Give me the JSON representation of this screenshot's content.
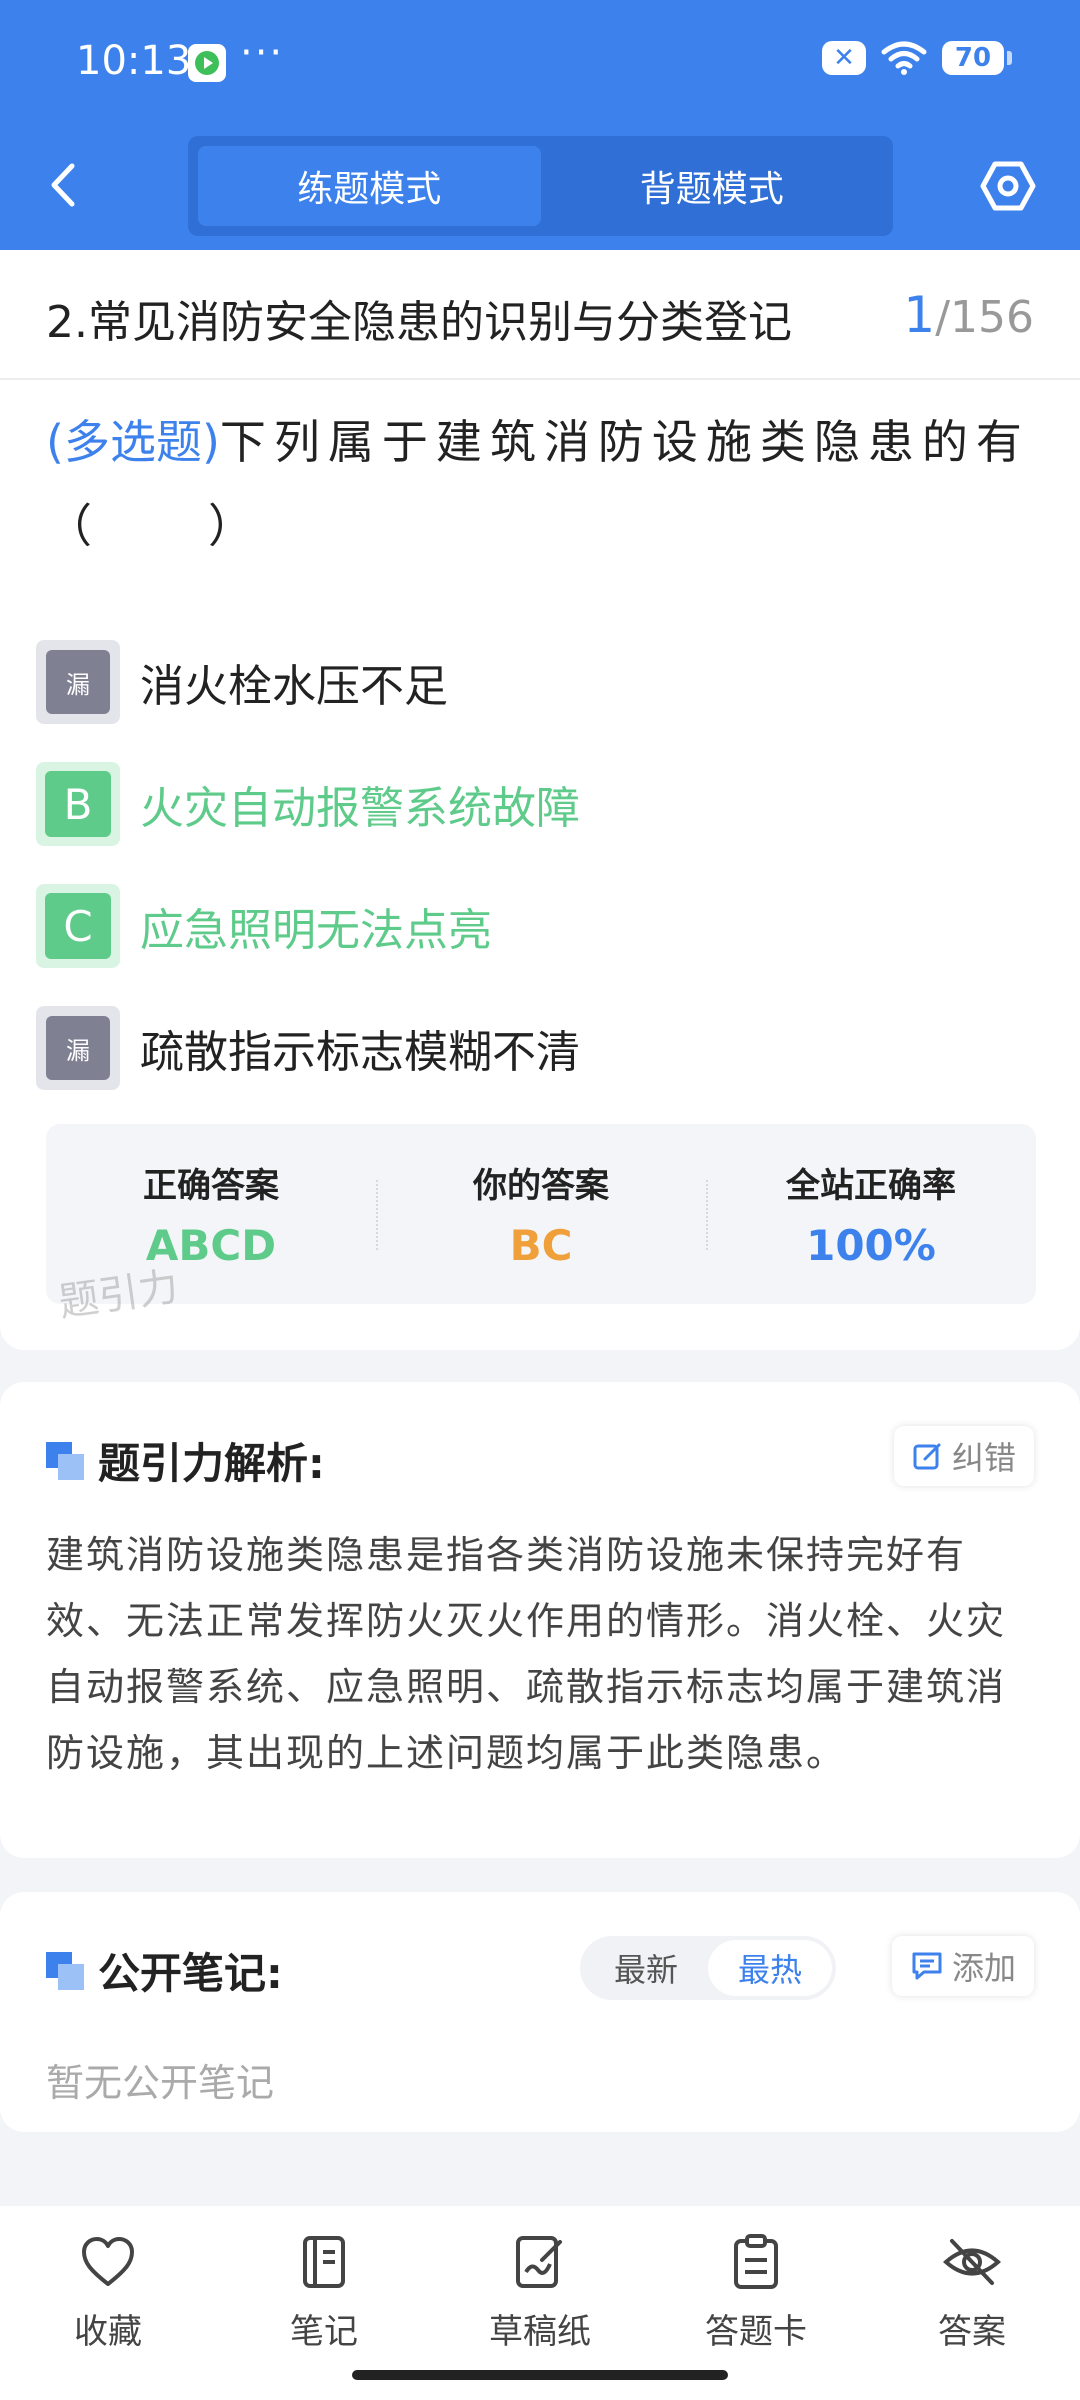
{
  "status_bar": {
    "time": "10:13",
    "dots": "···",
    "battery": "70"
  },
  "header": {
    "tabs": [
      {
        "label": "练题模式",
        "active": true
      },
      {
        "label": "背题模式",
        "active": false
      }
    ]
  },
  "question": {
    "section_title": "2.常见消防安全隐患的识别与分类登记",
    "current": "1",
    "total": "/156",
    "type": "(多选题)",
    "stem": "下列属于建筑消防设施类隐患的有（　　）",
    "options": [
      {
        "mark": "漏",
        "text": "消火栓水压不足",
        "state": "missed"
      },
      {
        "mark": "B",
        "text": "火灾自动报警系统故障",
        "state": "correct"
      },
      {
        "mark": "C",
        "text": "应急照明无法点亮",
        "state": "correct"
      },
      {
        "mark": "漏",
        "text": "疏散指示标志模糊不清",
        "state": "missed"
      }
    ],
    "answers": {
      "correct_label": "正确答案",
      "correct_value": "ABCD",
      "yours_label": "你的答案",
      "yours_value": "BC",
      "rate_label": "全站正确率",
      "rate_value": "100%"
    },
    "watermark": "题引力"
  },
  "analysis": {
    "title": "题引力解析:",
    "report_label": "纠错",
    "text": "建筑消防设施类隐患是指各类消防设施未保持完好有效、无法正常发挥防火灭火作用的情形。消火栓、火灾自动报警系统、应急照明、疏散指示标志均属于建筑消防设施，其出现的上述问题均属于此类隐患。"
  },
  "notes": {
    "title": "公开笔记:",
    "sort_latest": "最新",
    "sort_hot": "最热",
    "add_label": "添加",
    "empty_text": "暂无公开笔记"
  },
  "bottom_bar": [
    {
      "label": "收藏",
      "icon": "heart-icon"
    },
    {
      "label": "笔记",
      "icon": "notebook-icon"
    },
    {
      "label": "草稿纸",
      "icon": "draft-icon"
    },
    {
      "label": "答题卡",
      "icon": "answer-card-icon"
    },
    {
      "label": "答案",
      "icon": "eye-off-icon"
    }
  ],
  "colors": {
    "brand": "#3d82ec",
    "correct": "#5ecb8a",
    "yours": "#f0a03a"
  }
}
